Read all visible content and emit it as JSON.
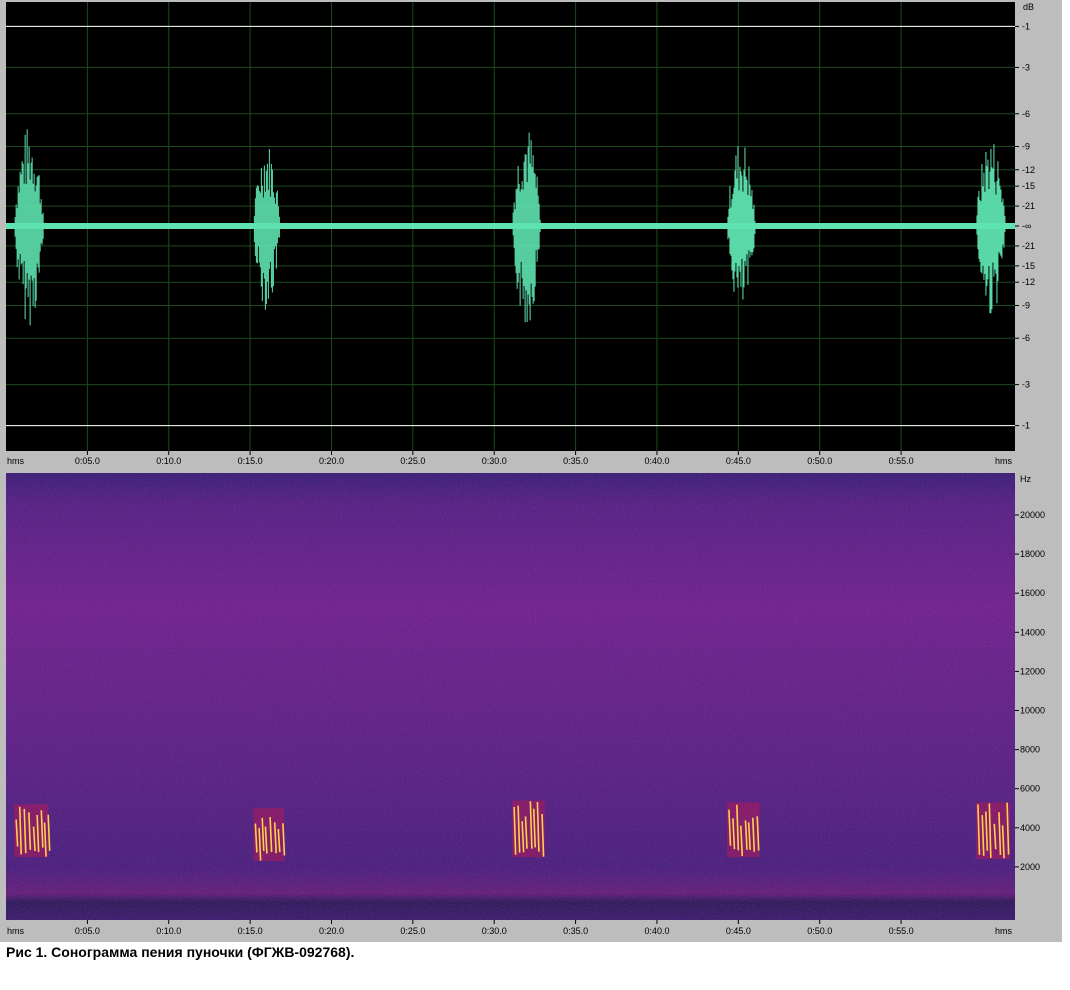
{
  "caption": "Рис 1. Сонограмма пения пуночки (ФГЖВ-092768).",
  "colors": {
    "waveform": "#5fe3b0",
    "wave_background": "#000000",
    "grid": "#1d4a1d",
    "spectrogram_base": "#3a1a6a",
    "spectrogram_energy": "#ffd04a",
    "panel": "#bdbdbd"
  },
  "chart_data": [
    {
      "type": "line",
      "kind": "waveform",
      "x_unit_label": "hms",
      "y_unit_label": "dB",
      "xlim": [
        0,
        62
      ],
      "x_ticks": [
        {
          "value": 5,
          "label": "0:05.0"
        },
        {
          "value": 10,
          "label": "0:10.0"
        },
        {
          "value": 15,
          "label": "0:15.0"
        },
        {
          "value": 20,
          "label": "0:20.0"
        },
        {
          "value": 25,
          "label": "0:25.0"
        },
        {
          "value": 30,
          "label": "0:30.0"
        },
        {
          "value": 35,
          "label": "0:35.0"
        },
        {
          "value": 40,
          "label": "0:40.0"
        },
        {
          "value": 45,
          "label": "0:45.0"
        },
        {
          "value": 50,
          "label": "0:50.0"
        },
        {
          "value": 55,
          "label": "0:55.0"
        }
      ],
      "y_ticks": [
        {
          "value": 0.891,
          "label": "-1"
        },
        {
          "value": 0.708,
          "label": "-3"
        },
        {
          "value": 0.501,
          "label": "-6"
        },
        {
          "value": 0.355,
          "label": "-9"
        },
        {
          "value": 0.251,
          "label": "-12"
        },
        {
          "value": 0.178,
          "label": "-15"
        },
        {
          "value": 0.089,
          "label": "-21"
        },
        {
          "value": 0,
          "label": "-∞"
        },
        {
          "value": -0.089,
          "label": "-21"
        },
        {
          "value": -0.178,
          "label": "-15"
        },
        {
          "value": -0.251,
          "label": "-12"
        },
        {
          "value": -0.355,
          "label": "-9"
        },
        {
          "value": -0.501,
          "label": "-6"
        },
        {
          "value": -0.708,
          "label": "-3"
        },
        {
          "value": -0.891,
          "label": "-1"
        }
      ],
      "ylim": [
        -1,
        1
      ],
      "clip_lines": [
        0.891,
        -0.891
      ],
      "bursts": [
        {
          "start": 0.5,
          "end": 2.6,
          "peak": 0.45
        },
        {
          "start": 15.2,
          "end": 17.1,
          "peak": 0.38
        },
        {
          "start": 31.1,
          "end": 33.1,
          "peak": 0.46
        },
        {
          "start": 44.3,
          "end": 46.3,
          "peak": 0.4
        },
        {
          "start": 59.6,
          "end": 61.7,
          "peak": 0.41
        }
      ]
    },
    {
      "type": "heatmap",
      "kind": "spectrogram",
      "x_unit_label": "hms",
      "y_unit_label": "Hz",
      "xlim": [
        0,
        62
      ],
      "ylim": [
        0,
        22050
      ],
      "x_ticks": [
        {
          "value": 5,
          "label": "0:05.0"
        },
        {
          "value": 10,
          "label": "0:10.0"
        },
        {
          "value": 15,
          "label": "0:15.0"
        },
        {
          "value": 20,
          "label": "0:20.0"
        },
        {
          "value": 25,
          "label": "0:25.0"
        },
        {
          "value": 30,
          "label": "0:30.0"
        },
        {
          "value": 35,
          "label": "0:35.0"
        },
        {
          "value": 40,
          "label": "0:40.0"
        },
        {
          "value": 45,
          "label": "0:45.0"
        },
        {
          "value": 50,
          "label": "0:50.0"
        },
        {
          "value": 55,
          "label": "0:55.0"
        }
      ],
      "y_ticks": [
        {
          "value": 2000,
          "label": "2000"
        },
        {
          "value": 4000,
          "label": "4000"
        },
        {
          "value": 6000,
          "label": "6000"
        },
        {
          "value": 8000,
          "label": "8000"
        },
        {
          "value": 10000,
          "label": "10000"
        },
        {
          "value": 12000,
          "label": "12000"
        },
        {
          "value": 14000,
          "label": "14000"
        },
        {
          "value": 16000,
          "label": "16000"
        },
        {
          "value": 18000,
          "label": "18000"
        },
        {
          "value": 20000,
          "label": "20000"
        }
      ],
      "energy_bands": [
        {
          "start": 0.5,
          "end": 2.6,
          "f_low": 2500,
          "f_high": 5200
        },
        {
          "start": 15.2,
          "end": 17.1,
          "f_low": 2300,
          "f_high": 5000
        },
        {
          "start": 31.1,
          "end": 33.1,
          "f_low": 2500,
          "f_high": 5400
        },
        {
          "start": 44.3,
          "end": 46.3,
          "f_low": 2500,
          "f_high": 5300
        },
        {
          "start": 59.6,
          "end": 61.7,
          "f_low": 2400,
          "f_high": 5300
        }
      ]
    }
  ]
}
